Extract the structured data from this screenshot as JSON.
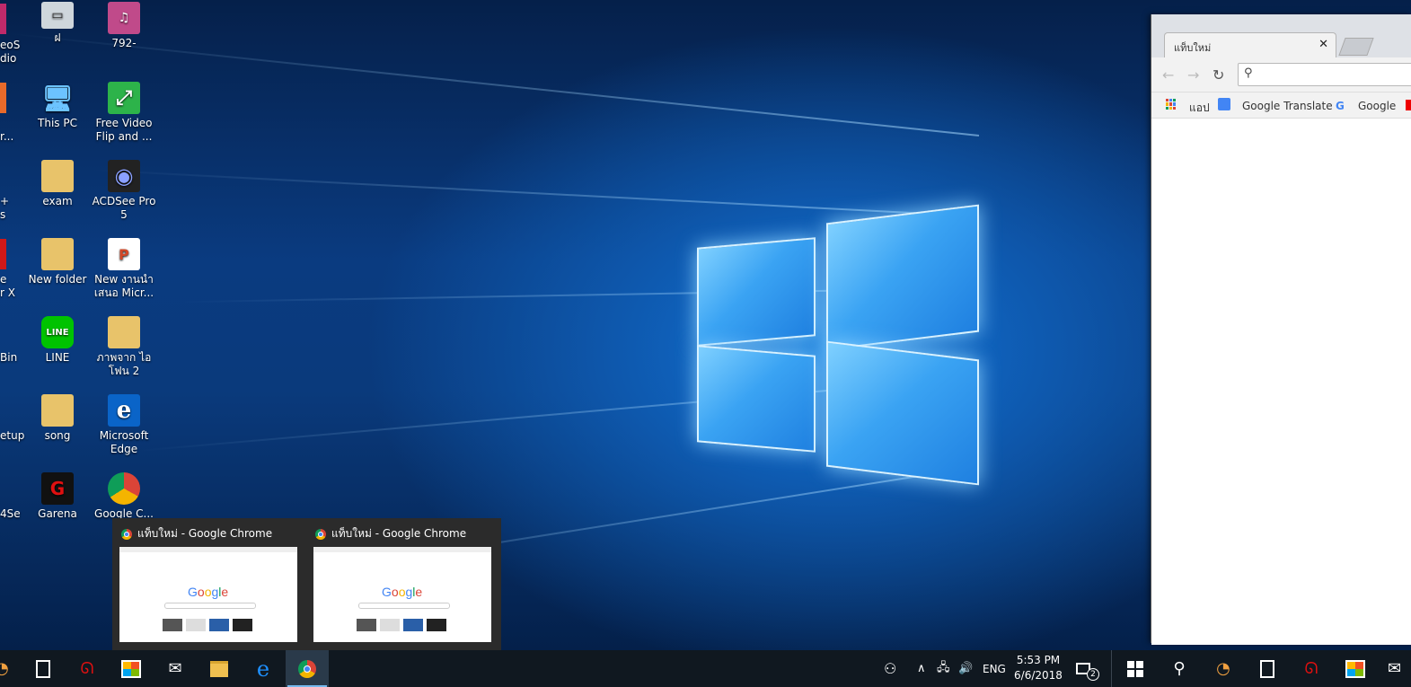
{
  "desktop": {
    "icons_col2": [
      {
        "label": "ฝ",
        "glyph": "▭",
        "color": "#cfd6dc"
      },
      {
        "label": "This PC",
        "glyph": "🖥",
        "color": "#1e90ff"
      },
      {
        "label": "exam",
        "glyph": "📁",
        "color": "#e8c36a"
      },
      {
        "label": "New folder",
        "glyph": "📁",
        "color": "#e8c36a"
      },
      {
        "label": "LINE",
        "glyph": "LINE",
        "color": "#00c300"
      },
      {
        "label": "song",
        "glyph": "📁",
        "color": "#e8c36a"
      },
      {
        "label": "Garena",
        "glyph": "G",
        "color": "#c00000"
      }
    ],
    "icons_col3": [
      {
        "label": "792-",
        "glyph": "♫",
        "color": "#c04a8a"
      },
      {
        "label": "Free Video Flip and ...",
        "glyph": "⤢",
        "color": "#2db34a"
      },
      {
        "label": "ACDSee Pro 5",
        "glyph": "◉",
        "color": "#222"
      },
      {
        "label": "New งานนำเสนอ Micr...",
        "glyph": "P",
        "color": "#d24726"
      },
      {
        "label": "ภาพจาก ไอโฟน 2",
        "glyph": "📁",
        "color": "#e8c36a"
      },
      {
        "label": "Microsoft Edge",
        "glyph": "e",
        "color": "#0a64c8"
      },
      {
        "label": "Google C...",
        "glyph": "◎",
        "color": "#fff"
      }
    ],
    "partial_col1": [
      "eoS",
      "dio",
      "r...",
      "+",
      "s",
      "e",
      "r X",
      "Bin",
      "etup",
      "4Se"
    ]
  },
  "chrome_window": {
    "tab_title": "แท็บใหม่",
    "close": "✕",
    "back": "←",
    "forward": "→",
    "reload": "↻",
    "search_icon": "⚲",
    "bookmarks": [
      "แอป",
      "Google Translate",
      "Google"
    ]
  },
  "thumbnail_popup": {
    "items": [
      {
        "title": "แท็บใหม่ - Google Chrome"
      },
      {
        "title": "แท็บใหม่ - Google Chrome"
      }
    ],
    "google_word": "Google"
  },
  "taskbar": {
    "tray": {
      "people": "⚇",
      "chevron": "∧",
      "network": "🖧",
      "volume": "🔊",
      "language": "ENG",
      "time": "5:53 PM",
      "date": "6/6/2018",
      "notifications_count": "2"
    }
  }
}
